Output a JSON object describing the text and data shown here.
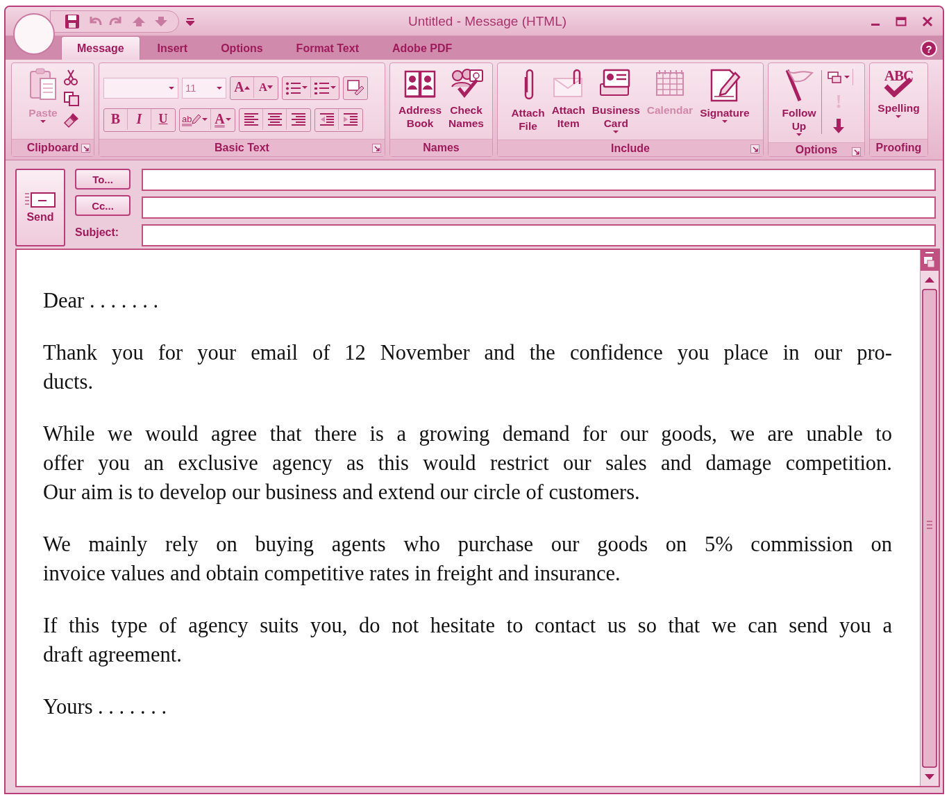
{
  "window": {
    "title": "Untitled - Message (HTML)",
    "help": "?"
  },
  "tabs": [
    {
      "label": "Message",
      "selected": true
    },
    {
      "label": "Insert",
      "selected": false
    },
    {
      "label": "Options",
      "selected": false
    },
    {
      "label": "Format Text",
      "selected": false
    },
    {
      "label": "Adobe PDF",
      "selected": false
    }
  ],
  "ribbon": [
    {
      "title": "Clipboard",
      "launcher": true,
      "buttons": [
        {
          "label": "Paste",
          "disabled": true,
          "dropdown": true
        }
      ]
    },
    {
      "title": "Basic Text",
      "launcher": true,
      "font_size": "11",
      "grow_font": "A",
      "shrink_font": "A",
      "bold": "B",
      "italic": "I",
      "underline": "U",
      "highlight": "ab",
      "font_color": "A"
    },
    {
      "title": "Names",
      "launcher": false,
      "buttons": [
        {
          "label": "Address\nBook",
          "disabled": false,
          "dropdown": false
        },
        {
          "label": "Check\nNames",
          "disabled": false,
          "dropdown": false
        }
      ]
    },
    {
      "title": "Include",
      "launcher": true,
      "buttons": [
        {
          "label": "Attach\nFile",
          "disabled": false,
          "dropdown": false
        },
        {
          "label": "Attach\nItem",
          "disabled": false,
          "dropdown": false
        },
        {
          "label": "Business\nCard",
          "disabled": false,
          "dropdown": true
        },
        {
          "label": "Calendar",
          "disabled": true,
          "dropdown": false
        },
        {
          "label": "Signature",
          "disabled": false,
          "dropdown": true
        }
      ]
    },
    {
      "title": "Options",
      "launcher": true,
      "buttons": [
        {
          "label": "Follow\nUp",
          "disabled": false,
          "dropdown": true
        }
      ]
    },
    {
      "title": "Proofing",
      "launcher": false,
      "buttons": [
        {
          "label": "Spelling",
          "disabled": false,
          "dropdown": true,
          "icon_text": "ABC"
        }
      ]
    }
  ],
  "header": {
    "send": "Send",
    "to": "To...",
    "cc": "Cc...",
    "subject": "Subject:"
  },
  "body": [
    {
      "lines": [
        "Dear . . . . . . ."
      ]
    },
    {
      "lines": [
        "Thank you for your email of 12 November and the confidence you place in our pro-",
        "ducts."
      ]
    },
    {
      "lines": [
        "While we would agree that there is a growing demand for our goods, we are unable to",
        "offer you an exclusive agency as this would restrict our sales and damage competition.",
        "Our aim is to develop our business and extend our circle of customers."
      ]
    },
    {
      "lines": [
        "We mainly rely on buying agents who purchase our goods on 5% commission on",
        "invoice values and obtain competitive rates in freight and insurance."
      ]
    },
    {
      "lines": [
        "If this type of agency suits you, do not hesitate to contact us so that we can send you a",
        "draft agreement."
      ]
    },
    {
      "lines": [
        "Yours . . . . . . ."
      ]
    }
  ]
}
